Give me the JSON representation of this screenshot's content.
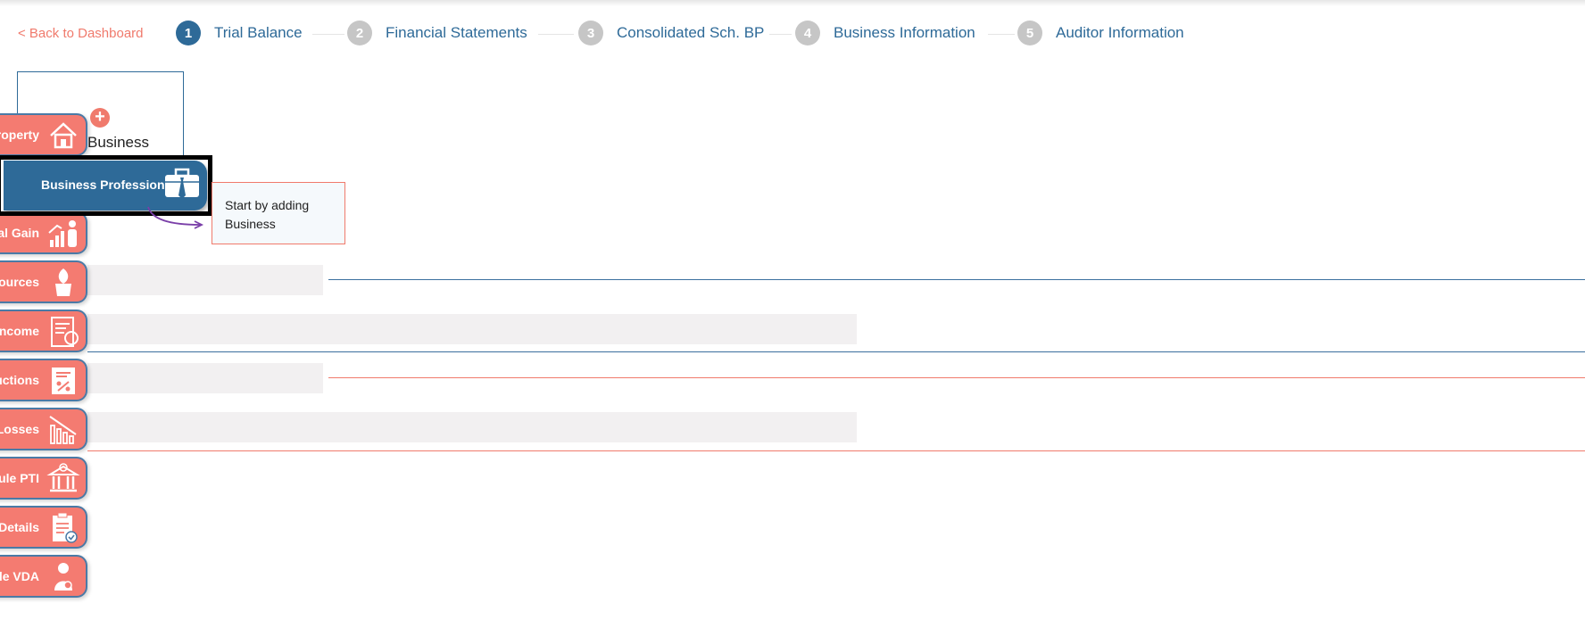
{
  "nav": {
    "back_label": "< Back to Dashboard",
    "steps": [
      {
        "num": "1",
        "label": "Trial Balance"
      },
      {
        "num": "2",
        "label": "Financial Statements"
      },
      {
        "num": "3",
        "label": "Consolidated Sch. BP"
      },
      {
        "num": "4",
        "label": "Business Information"
      },
      {
        "num": "5",
        "label": "Auditor Information"
      }
    ]
  },
  "card": {
    "label": "Business",
    "add_symbol": "+"
  },
  "tooltip": {
    "text": "Start by adding Business"
  },
  "sidebar": {
    "active": {
      "label": "Business Profession",
      "icon": "briefcase-icon"
    },
    "items": [
      {
        "label": "roperty",
        "icon": "house-icon"
      },
      {
        "label": "al Gain",
        "icon": "growth-chart-icon"
      },
      {
        "label": "Sources",
        "icon": "plant-icon"
      },
      {
        "label": "ncome",
        "icon": "tax-receipt-icon"
      },
      {
        "label": "uctions",
        "icon": "tax-percent-icon"
      },
      {
        "label": "Losses",
        "icon": "declining-chart-icon"
      },
      {
        "label": "ule PTI",
        "icon": "bank-icon"
      },
      {
        "label": "Details",
        "icon": "tax-clipboard-icon"
      },
      {
        "label": "ule VDA",
        "icon": "person-icon"
      }
    ]
  },
  "colors": {
    "accent": "#2e6a98",
    "brand": "#f47b71",
    "skeleton": "#f2f0f1"
  }
}
